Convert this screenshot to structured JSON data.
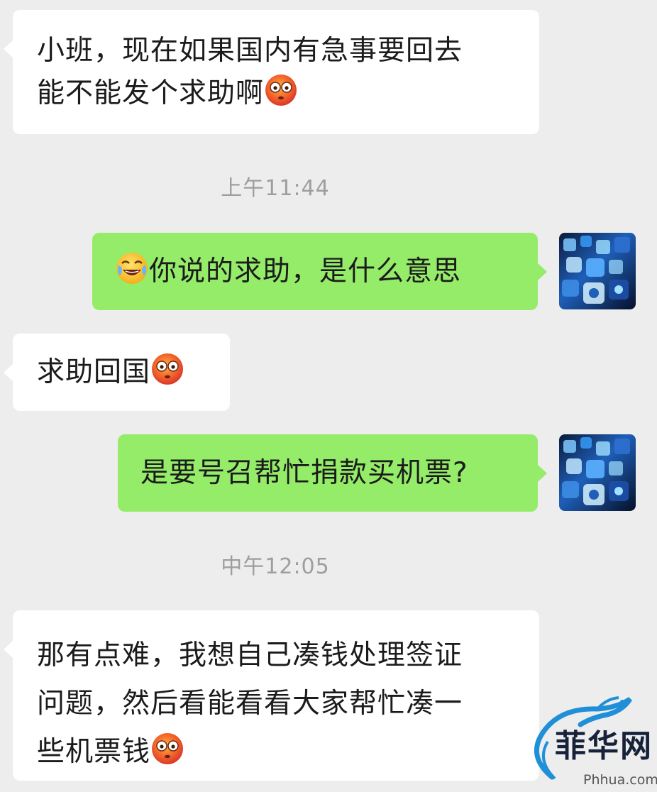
{
  "messages": [
    {
      "side": "in",
      "lines": [
        "小班，现在如果国内有急事要回去",
        "能不能发个求助啊"
      ],
      "emoji": "flushed-face"
    },
    {
      "side": "out",
      "lead_emoji": "tears-of-joy-face",
      "text": "你说的求助，是什么意思"
    },
    {
      "side": "in",
      "text": "求助回国",
      "emoji": "flushed-face"
    },
    {
      "side": "out",
      "text": "是要号召帮忙捐款买机票?"
    },
    {
      "side": "in",
      "lines": [
        "那有点难，我想自己凑钱处理签证",
        "问题，然后看能看看大家帮忙凑一",
        "些机票钱"
      ],
      "emoji": "flushed-face"
    }
  ],
  "timestamps": [
    "上午11:44",
    "中午12:05"
  ],
  "watermark": {
    "brand_text": "菲华网",
    "site": "Phhua.com"
  },
  "colors": {
    "background": "#ededed",
    "incoming_bubble": "#ffffff",
    "outgoing_bubble": "#95ec69",
    "timestamp": "#9e9e9e"
  }
}
